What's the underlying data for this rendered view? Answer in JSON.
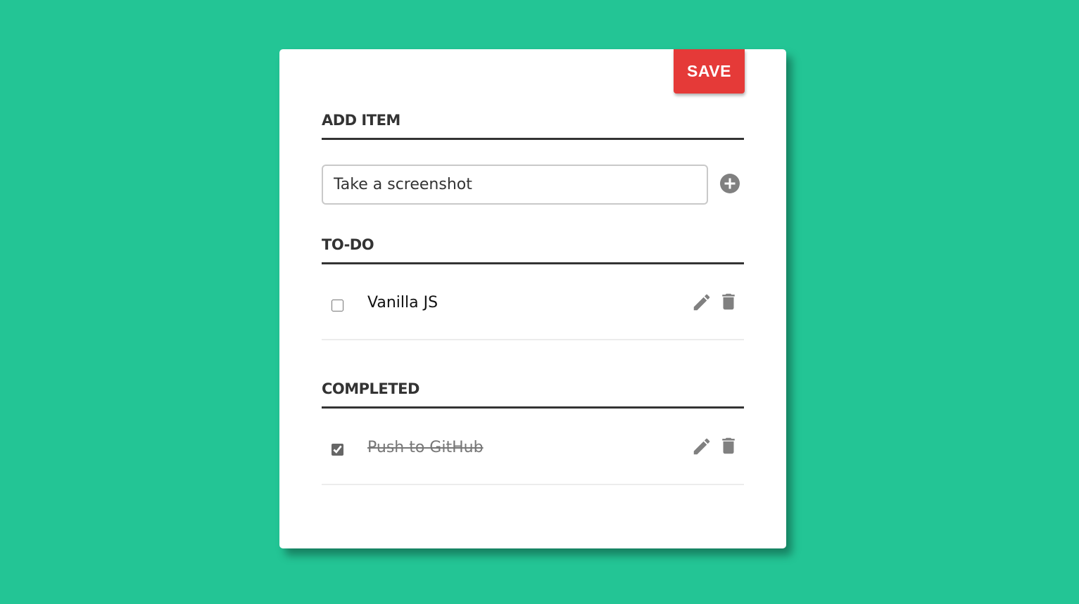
{
  "colors": {
    "background": "#23c595",
    "card": "#ffffff",
    "save_button": "#e53a38",
    "icon_gray": "#808080",
    "heading": "#333333"
  },
  "toolbar": {
    "save_label": "SAVE"
  },
  "add_section": {
    "title": "ADD ITEM",
    "input_value": "Take a screenshot",
    "add_icon": "plus-circle-icon"
  },
  "todo_section": {
    "title": "TO-DO",
    "items": [
      {
        "label": "Vanilla JS",
        "checked": false,
        "edit_icon": "pencil-icon",
        "delete_icon": "trash-icon"
      }
    ]
  },
  "completed_section": {
    "title": "COMPLETED",
    "items": [
      {
        "label": "Push to GitHub",
        "checked": true,
        "edit_icon": "pencil-icon",
        "delete_icon": "trash-icon"
      }
    ]
  }
}
